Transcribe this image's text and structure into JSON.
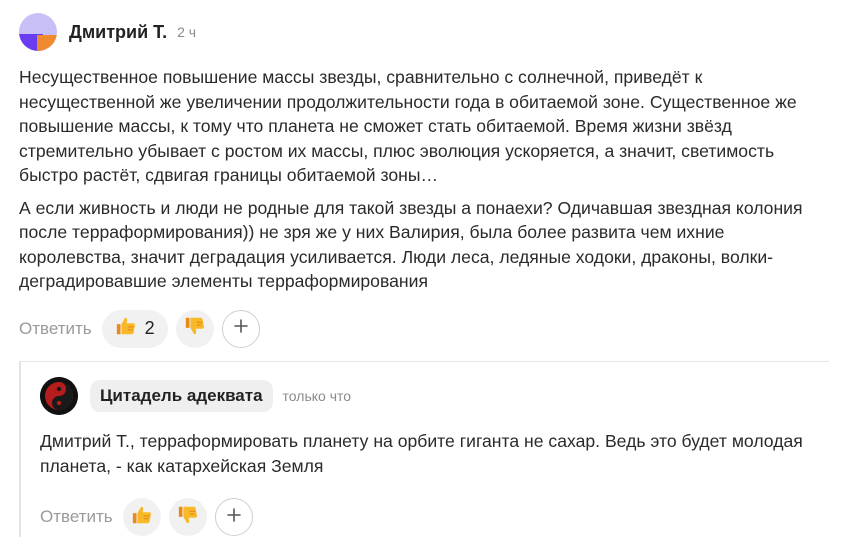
{
  "comment": {
    "author": "Дмитрий Т.",
    "time": "2 ч",
    "paragraphs": [
      "Несущественное повышение массы звезды, сравнительно с солнечной, приведёт к несущественной же увеличении продолжительности года в обитаемой зоне. Существенное же повышение массы, к тому что планета не сможет стать обитаемой. Время жизни звёзд стремительно убывает с ростом их массы, плюс эволюция ускоряется, а значит, светимость быстро растёт, сдвигая границы обитаемой зоны…",
      "А если живность и люди не родные для такой звезды а понаехи? Одичавшая звездная колония после терраформирования)) не зря же у них Валирия, была более развита чем ихние королевства, значит деградация усиливается. Люди леса, ледяные ходоки, драконы, волки- деградировавшие элементы терраформирования"
    ],
    "actions": {
      "reply_label": "Ответить",
      "like_count": "2",
      "like_icon": "thumbs-up-emoji",
      "dislike_icon": "thumbs-down-emoji",
      "add_icon": "plus-icon"
    }
  },
  "reply": {
    "author": "Цитадель адеквата",
    "time": "только что",
    "text": "Дмитрий Т., терраформировать планету на орбите гиганта не сахар. Ведь это будет молодая планета, - как катархейская Земля",
    "actions": {
      "reply_label": "Ответить",
      "like_icon": "thumbs-up-emoji",
      "dislike_icon": "thumbs-down-emoji",
      "add_icon": "plus-icon"
    }
  },
  "colors": {
    "emoji_yellow": "#f7b928",
    "emoji_orange": "#e8891a",
    "muted_text": "#9a9a9a",
    "pill_bg": "#f1f1f1"
  }
}
